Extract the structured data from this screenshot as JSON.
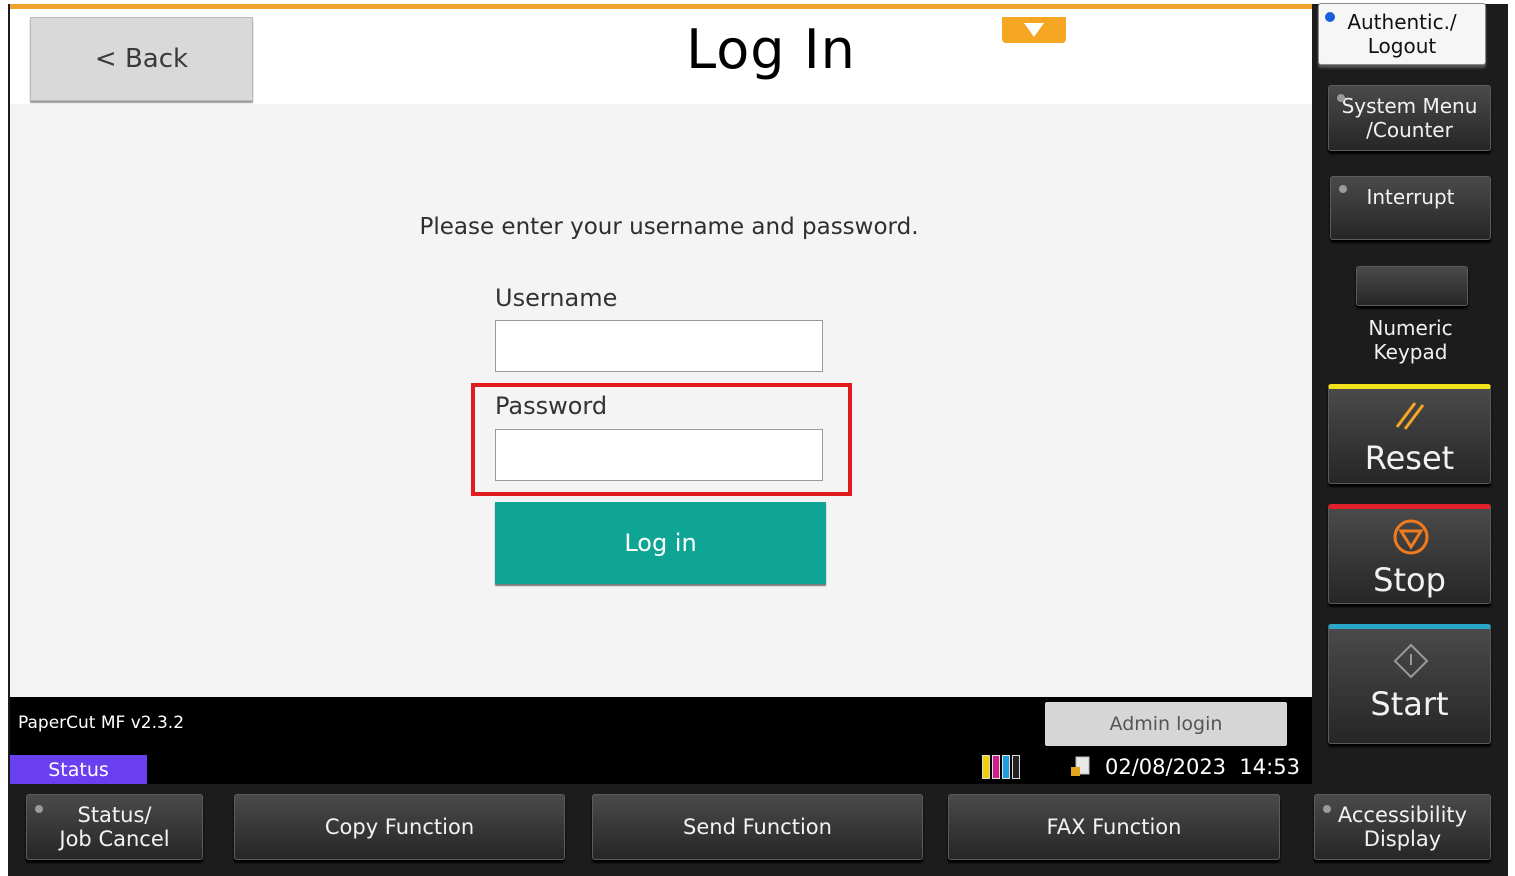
{
  "header": {
    "back_label": "< Back",
    "title": "Log In"
  },
  "form": {
    "prompt": "Please enter your username and password.",
    "username_label": "Username",
    "username_value": "",
    "password_label": "Password",
    "password_value": "",
    "login_label": "Log in"
  },
  "footer": {
    "version": "PaperCut MF v2.3.2",
    "status_tab": "Status",
    "admin_login": "Admin login",
    "date": "02/08/2023",
    "time": "14:53"
  },
  "side_panel": {
    "authentic_logout": [
      "Authentic./",
      "Logout"
    ],
    "system_menu": [
      "System Menu",
      "/Counter"
    ],
    "interrupt": "Interrupt",
    "numeric_keypad": [
      "Numeric",
      "Keypad"
    ],
    "reset": "Reset",
    "stop": "Stop",
    "start": "Start"
  },
  "bottom_bar": {
    "status_job_cancel": [
      "Status/",
      "Job Cancel"
    ],
    "copy_function": "Copy Function",
    "send_function": "Send Function",
    "fax_function": "FAX Function",
    "accessibility_display": [
      "Accessibility",
      "Display"
    ]
  },
  "colors": {
    "accent_orange": "#f5a623",
    "login_teal": "#0ea594",
    "highlight_red": "#e21c1c",
    "status_purple": "#6a3ff0",
    "reset_yellow": "#f2e21a",
    "stop_red": "#e0202a",
    "stop_orange": "#f07b1e",
    "start_blue": "#2aa7c9"
  },
  "icons": [
    "chevron-down-icon",
    "toner-levels-icon",
    "document-lock-icon",
    "reset-slash-icon",
    "stop-circle-icon",
    "start-diamond-icon"
  ]
}
